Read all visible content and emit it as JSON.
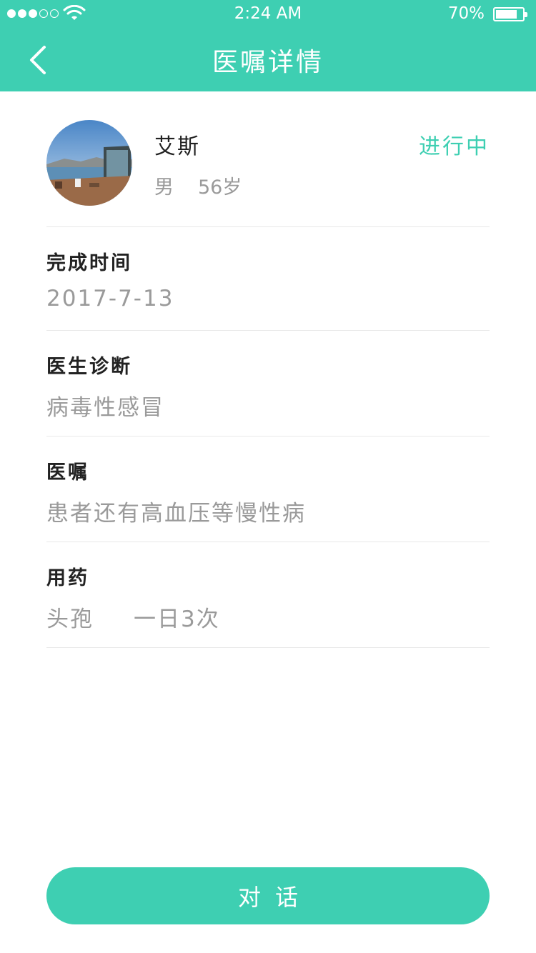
{
  "status_bar": {
    "time": "2:24 AM",
    "battery_percent": "70%",
    "battery_level": 0.7,
    "signal_bars_filled": 3,
    "signal_bars_total": 5
  },
  "nav": {
    "title": "医嘱详情",
    "back_icon": "chevron-left-icon"
  },
  "patient": {
    "name": "艾斯",
    "gender": "男",
    "age": "56岁",
    "status": "进行中"
  },
  "sections": {
    "completion": {
      "label": "完成时间",
      "value": "2017-7-13"
    },
    "diagnosis": {
      "label": "医生诊断",
      "value": "病毒性感冒"
    },
    "advice": {
      "label": "医嘱",
      "value": "患者还有高血压等慢性病"
    },
    "medication": {
      "label": "用药",
      "drug": "头孢",
      "frequency": "一日3次"
    }
  },
  "footer": {
    "dialog_button": "对话"
  },
  "colors": {
    "accent": "#3ecfb2",
    "text_primary": "#222222",
    "text_secondary": "#9a9a9a",
    "divider": "#e8e8e8"
  }
}
